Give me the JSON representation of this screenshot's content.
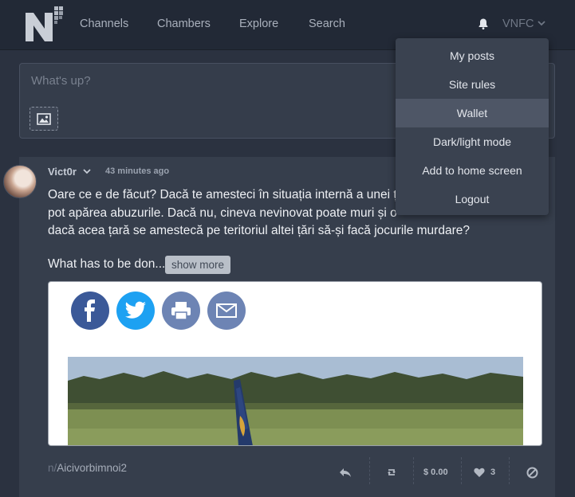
{
  "header": {
    "logo_text": "N",
    "nav": [
      "Channels",
      "Chambers",
      "Explore",
      "Search"
    ],
    "notification_icon": "bell-icon",
    "user": "VNFC"
  },
  "composer": {
    "placeholder": "What's up?",
    "image_button_icon": "image-icon"
  },
  "user_menu": {
    "items": [
      "My posts",
      "Site rules",
      "Wallet",
      "Dark/light mode",
      "Add to home screen",
      "Logout"
    ],
    "highlighted": "Wallet"
  },
  "post": {
    "author": "Vict0r",
    "time": "43 minutes ago",
    "body": "Oare ce e de făcut? Dacă te amesteci în situația internă a unei ț\npot apărea abuzurile. Dacă nu, cineva nevinovat poate muri și o\ndacă acea țară se amestecă pe teritoriul altei țări să-și facă jocurile murdare?",
    "preview": "What has to be don...",
    "show_more": "show more",
    "embed_share_icons": [
      "facebook-icon",
      "twitter-icon",
      "print-icon",
      "email-icon"
    ],
    "channel_prefix": "n/",
    "channel": "Aicivorbimnoi2",
    "tip_amount": "$ 0.00",
    "likes": "3"
  },
  "colors": {
    "background": "#2b3240",
    "topbar": "#222936",
    "card": "#363e4c",
    "menu": "#3a4250",
    "facebook": "#3b5998",
    "twitter": "#1da1f2",
    "print": "#6d84b4",
    "email": "#6d84b4"
  }
}
